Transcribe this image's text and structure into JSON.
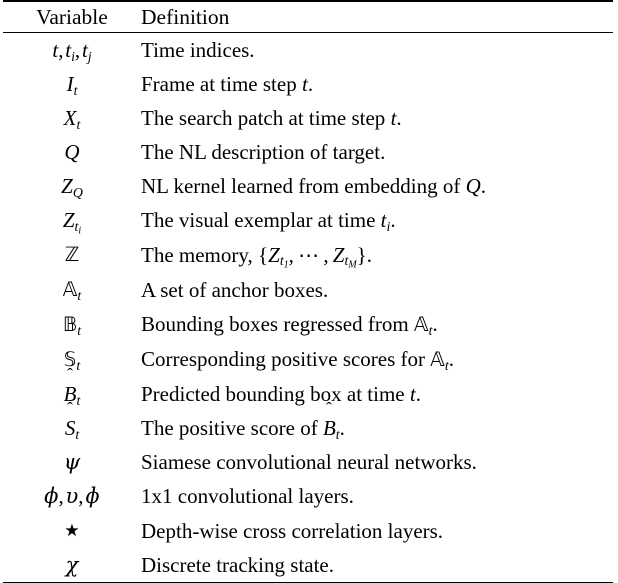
{
  "table": {
    "headers": {
      "variable": "Variable",
      "definition": "Definition"
    },
    "rows": [
      {
        "variable_text": "t, t_i, t_j",
        "definition_text": "Time indices."
      },
      {
        "variable_text": "I_t",
        "definition_text": "Frame at time step t."
      },
      {
        "variable_text": "X_t",
        "definition_text": "The search patch at time step t."
      },
      {
        "variable_text": "Q",
        "definition_text": "The NL description of target."
      },
      {
        "variable_text": "Z_Q",
        "definition_text": "NL kernel learned from embedding of Q."
      },
      {
        "variable_text": "Z_{t_i}",
        "definition_text": "The visual exemplar at time t_i."
      },
      {
        "variable_text": "Z (blackboard)",
        "definition_text": "The memory, {Z_{t_1}, ... , Z_{t_M}}."
      },
      {
        "variable_text": "A_t (blackboard)",
        "definition_text": "A set of anchor boxes."
      },
      {
        "variable_text": "B_t (blackboard)",
        "definition_text": "Bounding boxes regressed from A_t."
      },
      {
        "variable_text": "S_t (blackboard)",
        "definition_text": "Corresponding positive scores for A_t."
      },
      {
        "variable_text": "B-hat_t",
        "definition_text": "Predicted bounding box at time t."
      },
      {
        "variable_text": "S-hat_t",
        "definition_text": "The positive score of B-hat_t."
      },
      {
        "variable_text": "psi",
        "definition_text": "Siamese convolutional neural networks."
      },
      {
        "variable_text": "varphi, upsilon, phi",
        "definition_text": "1x1 convolutional layers."
      },
      {
        "variable_text": "star",
        "definition_text": "Depth-wise cross correlation layers."
      },
      {
        "variable_text": "chi",
        "definition_text": "Discrete tracking state."
      }
    ]
  },
  "colors": {
    "text": "#000000",
    "background": "#ffffff",
    "rule": "#000000"
  }
}
